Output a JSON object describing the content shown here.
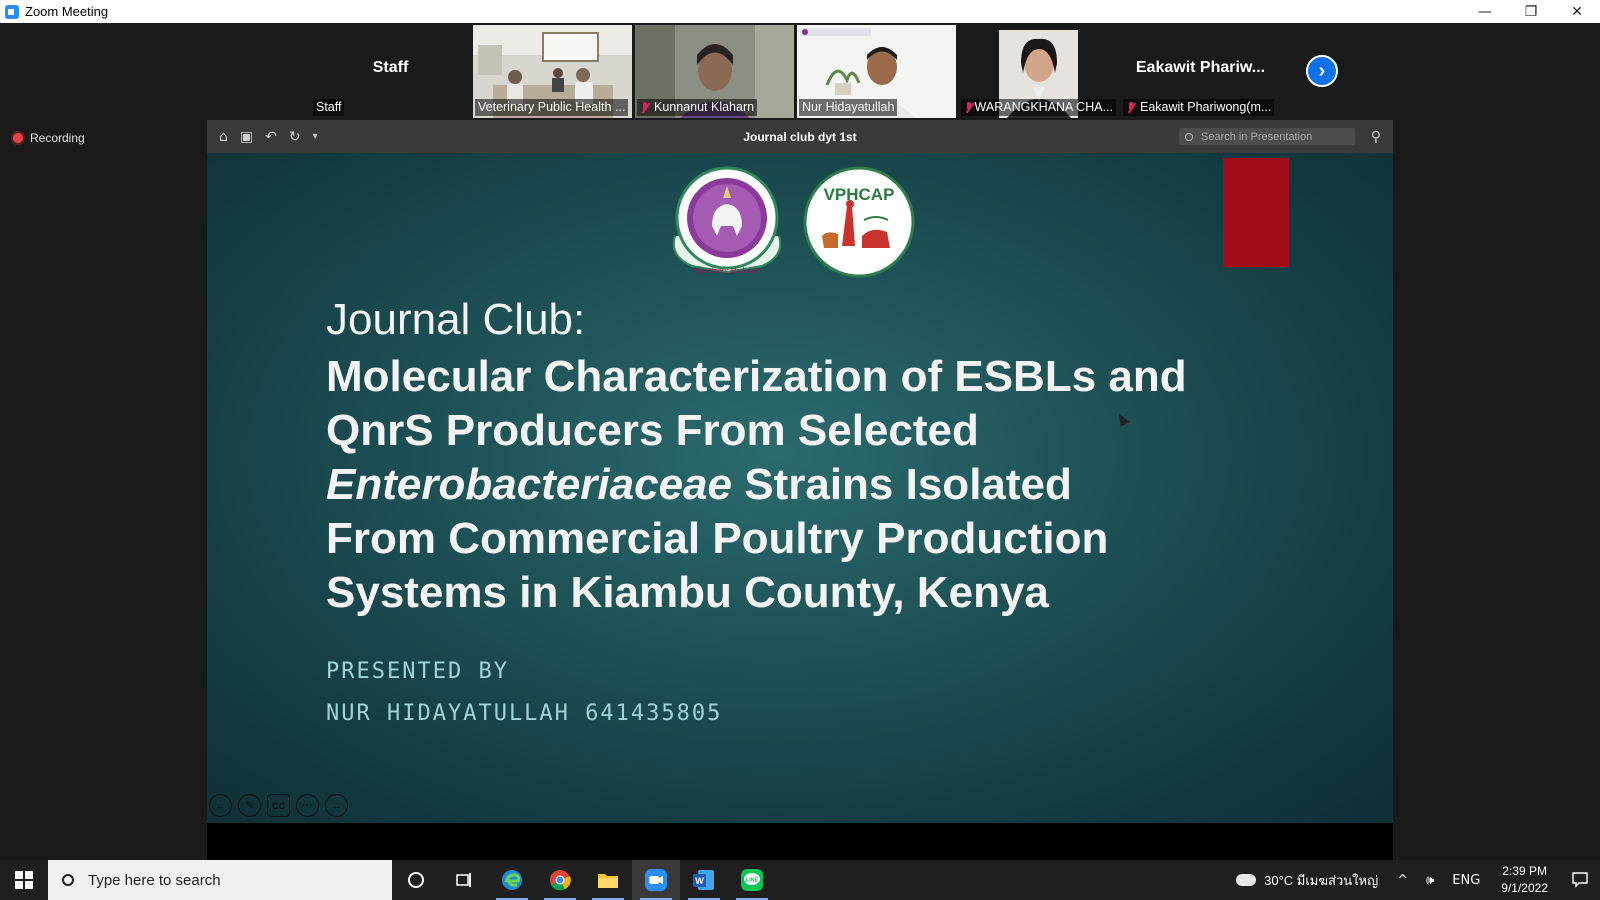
{
  "window": {
    "title": "Zoom Meeting",
    "controls": {
      "minimize": "—",
      "restore": "❐",
      "close": "✕"
    }
  },
  "recording": {
    "label": "Recording"
  },
  "gallery": {
    "tiles": [
      {
        "big_name": "Staff",
        "name": "Staff",
        "muted": false,
        "video": false
      },
      {
        "big_name": "",
        "name": "Veterinary Public Health ...",
        "muted": false,
        "video": true
      },
      {
        "big_name": "",
        "name": "Kunnanut Klaharn",
        "muted": true,
        "video": true
      },
      {
        "big_name": "",
        "name": "Nur Hidayatullah",
        "muted": false,
        "video": true,
        "active": true
      },
      {
        "big_name": "",
        "name": "WARANGKHANA CHA...",
        "muted": true,
        "video": true
      },
      {
        "big_name": "Eakawit  Phariw...",
        "name": "Eakawit Phariwong(m...",
        "muted": true,
        "video": false
      }
    ],
    "next_icon": "›"
  },
  "presentation": {
    "file_name": "Journal club dyt 1st",
    "search_placeholder": "Search in Presentation",
    "toolbar_icons": [
      "home-icon",
      "save-icon",
      "undo-icon",
      "redo-icon",
      "more-icon"
    ],
    "slide": {
      "heading": "Journal Club:",
      "title_line1": "Molecular Characterization of ESBLs and",
      "title_line2": "QnrS Producers From Selected",
      "title_italic": "Enterobacteriaceae",
      "title_line3_rest": " Strains Isolated",
      "title_line4": "From Commercial Poultry Production",
      "title_line5": "Systems in Kiambu County, Kenya",
      "presented_by": "PRESENTED BY",
      "presenter": "NUR HIDAYATULLAH 641435805",
      "logo2_text": "VPHCAP",
      "accent_red": "#a00c18",
      "text_teal": "#9fd5d6"
    },
    "slide_controls": {
      "prev": "←",
      "pen": "✎",
      "cc": "CC",
      "more": "···",
      "next": "→"
    }
  },
  "taskbar": {
    "search_placeholder": "Type here to search",
    "weather": "30°C  มีเมฆส่วนใหญ่",
    "language": "ENG",
    "time": "2:39 PM",
    "date": "9/1/2022"
  }
}
